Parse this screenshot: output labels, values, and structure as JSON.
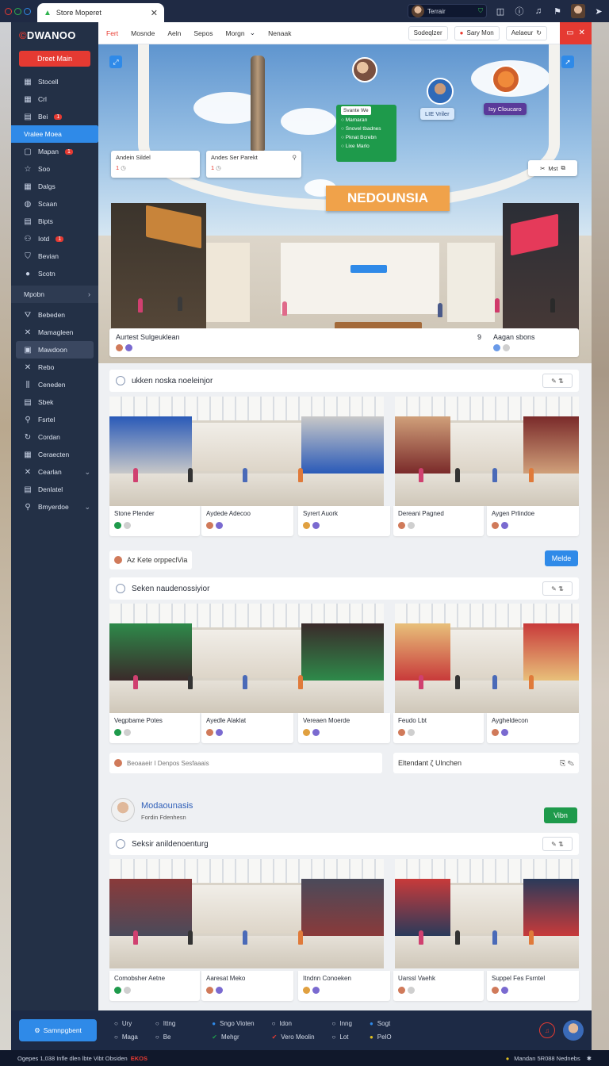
{
  "browser": {
    "tab_title": "Store Moperet",
    "profile_label": "Terrair",
    "colors": {
      "bar": "#1f2a44",
      "accent": "#2f8ae8",
      "danger": "#e53a32"
    }
  },
  "sidebar": {
    "logo_main": "DWANOO",
    "logo_accent": "©",
    "new_button": "Dreet Main",
    "items": [
      {
        "icon": "grid-icon",
        "glyph": "▦",
        "label": "Stocell"
      },
      {
        "icon": "grid-icon",
        "glyph": "▦",
        "label": "Crl"
      },
      {
        "icon": "doc-icon",
        "glyph": "▤",
        "label": "Bei",
        "badge": "1"
      },
      {
        "icon": "active-icon",
        "glyph": "",
        "label": "Vralee Moea",
        "active": true
      },
      {
        "icon": "square-icon",
        "glyph": "▢",
        "label": "Mapan",
        "badge": "1"
      },
      {
        "icon": "star-icon",
        "glyph": "☆",
        "label": "Soo"
      },
      {
        "icon": "grid-icon",
        "glyph": "▦",
        "label": "Dalgs"
      },
      {
        "icon": "globe-icon",
        "glyph": "◍",
        "label": "Scaan"
      },
      {
        "icon": "doc-icon",
        "glyph": "▤",
        "label": "Bipts"
      },
      {
        "icon": "people-icon",
        "glyph": "⚇",
        "label": "Iotd",
        "badge": "1"
      },
      {
        "icon": "bag-icon",
        "glyph": "⛉",
        "label": "Bevian"
      },
      {
        "icon": "record-icon",
        "glyph": "●",
        "label": "Scotn"
      }
    ],
    "section_label": "Mpobn",
    "items2": [
      {
        "icon": "filter-icon",
        "glyph": "⛛",
        "label": "Bebeden"
      },
      {
        "icon": "cross-icon",
        "glyph": "✕",
        "label": "Mamagleen"
      },
      {
        "icon": "store-icon",
        "glyph": "▣",
        "label": "Mawdoon",
        "highlight": true
      },
      {
        "icon": "cross-icon",
        "glyph": "✕",
        "label": "Rebo"
      },
      {
        "icon": "bars-icon",
        "glyph": "⫼",
        "label": "Ceneden"
      },
      {
        "icon": "doc-icon",
        "glyph": "▤",
        "label": "Sbek"
      },
      {
        "icon": "pin-icon",
        "glyph": "⚲",
        "label": "Fsrtel"
      },
      {
        "icon": "refresh-icon",
        "glyph": "↻",
        "label": "Cordan"
      },
      {
        "icon": "grid-icon",
        "glyph": "▦",
        "label": "Ceraecten"
      },
      {
        "icon": "cross-icon",
        "glyph": "✕",
        "label": "Cearlan",
        "chev": "⌄"
      },
      {
        "icon": "doc-icon",
        "glyph": "▤",
        "label": "Denlatel"
      },
      {
        "icon": "search-icon",
        "glyph": "⚲",
        "label": "Bmyerdoe",
        "chev": "⌄"
      }
    ]
  },
  "topnav": {
    "links": [
      "Fert",
      "Mosnde",
      "Aeln",
      "Sepos",
      "Morgn",
      "Nenaak"
    ],
    "pill1": "Sodeqlzer",
    "pill2": "Sary Mon",
    "pill3": "Aelaeur"
  },
  "hero": {
    "banner": "NEDOUNSIA",
    "card1": {
      "title": "Andein Sildel",
      "meta": "1"
    },
    "card2": {
      "title": "Andes Ser Parekt",
      "meta": "1"
    },
    "green_panel": {
      "title": "Svante We",
      "lines": [
        "Mamaran",
        "Snovel tbadnes",
        "Pknat Bcrebn",
        "Lixe Marlo"
      ]
    },
    "blue_tag": "LIE Vriler",
    "purple_tag": "Isy Cloucaro",
    "mst_button": "Mst",
    "caption_left": "Aurtest Sulgeuklean",
    "caption_right": "Aagan sbons",
    "caption_count": "9"
  },
  "section1": {
    "title": "ukken noska noeleinjor",
    "cards": [
      "Stone Plender",
      "Aydede Adecoo",
      "Syrert Auork",
      "Dereani Pagned",
      "Aygen Prlindoe"
    ]
  },
  "chip1": {
    "label": "Az Kete orppeclVia",
    "cta": "Melde"
  },
  "section2": {
    "title": "Seken naudenossiyior",
    "cards": [
      "Vegpbame Potes",
      "Ayedle Alaklat",
      "Vereaen Moerde",
      "Feudo Lbt",
      "Aygheldecon"
    ]
  },
  "chip2": {
    "left": "Beoaaeir I Denpos Sesfaaais",
    "right": "Eltendant ζ Ulnchen"
  },
  "profile": {
    "name": "Modaounasis",
    "sub": "Fordin Fdenhesn",
    "cta": "Vibn"
  },
  "section3": {
    "title": "Seksir anildenoenturg",
    "cards": [
      "Comobsher Aetne",
      "Aaresat Meko",
      "Itndnn Conoeken",
      "Uarssl Vaehk",
      "Suppel Fes Fsrntel"
    ]
  },
  "bottombar": {
    "button": "Samnpgbent",
    "col1": [
      "Ury",
      "Maga"
    ],
    "col2": [
      "Ittng",
      "Be"
    ],
    "col3": [
      "Sngo Vioten",
      "Mehgr"
    ],
    "col4": [
      "Idon",
      "Vero Meolin"
    ],
    "col5": [
      "Inng",
      "Lot"
    ],
    "col6": [
      "Sogt",
      "PelO"
    ]
  },
  "statusbar": {
    "left": "Ogepes 1,038 Infle dlen lbte Vibt Obsiden",
    "left_accent": "EKOS",
    "right": "Mandan 5R088 Nednebs"
  }
}
